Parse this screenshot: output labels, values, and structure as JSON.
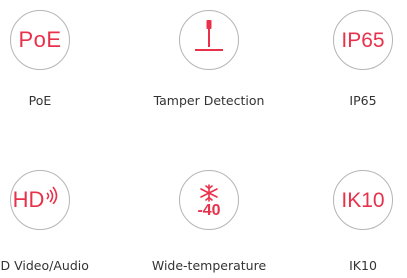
{
  "features": [
    {
      "icon": "poe-text-icon",
      "icon_text": "PoE",
      "label": "PoE"
    },
    {
      "icon": "tamper-detection-icon",
      "icon_text": "",
      "label": "Tamper Detection"
    },
    {
      "icon": "ip65-text-icon",
      "icon_text": "IP65",
      "label": "IP65"
    },
    {
      "icon": "hd-audio-icon",
      "icon_text": "HD",
      "label": "HD Video/Audio"
    },
    {
      "icon": "snowflake-temperature-icon",
      "icon_text": "-40",
      "label": "Wide-temperature"
    },
    {
      "icon": "ik10-text-icon",
      "icon_text": "IK10",
      "label": "IK10"
    }
  ],
  "colors": {
    "accent": "#e8314b",
    "circle_border": "#b5b5b5",
    "label": "#333333"
  }
}
